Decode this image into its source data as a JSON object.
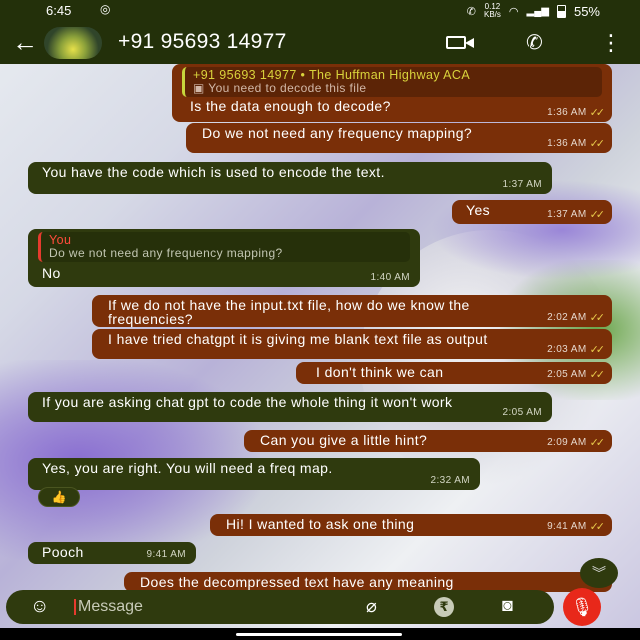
{
  "status": {
    "time": "6:45",
    "notif_icon": "instagram-icon",
    "speed_value": "0.12",
    "speed_unit": "KB/s",
    "battery": "55%"
  },
  "header": {
    "contact": "+91 95693 14977",
    "icons": [
      "back-arrow-icon",
      "video-call-icon",
      "phone-icon",
      "more-menu-icon"
    ]
  },
  "messages": [
    {
      "dir": "out",
      "quote_author": "+91 95693 14977 • The Huffman Highway ACA",
      "quote_text": "You need to decode this file",
      "text": "Is the data enough to decode?",
      "time": "1:36 AM"
    },
    {
      "dir": "out",
      "text": "Do we not need any frequency mapping?",
      "time": "1:36 AM"
    },
    {
      "dir": "in",
      "text": "You have the code which is used to encode the text.",
      "time": "1:37 AM"
    },
    {
      "dir": "out",
      "text": "Yes",
      "time": "1:37 AM"
    },
    {
      "dir": "in",
      "quote_author": "You",
      "quote_text": "Do we not need any frequency mapping?",
      "text": "No",
      "time": "1:40 AM"
    },
    {
      "dir": "out",
      "text": "If we do not have the input.txt file, how do we know the frequencies?",
      "time": "2:02 AM"
    },
    {
      "dir": "out",
      "text": "I have tried chatgpt it is giving me blank text file as output",
      "time": "2:03 AM"
    },
    {
      "dir": "out",
      "text": "I don't think we can",
      "time": "2:05 AM"
    },
    {
      "dir": "in",
      "text": "If you are asking chat gpt to code the whole thing it won't work",
      "time": "2:05 AM"
    },
    {
      "dir": "out",
      "text": "Can you give a little hint?",
      "time": "2:09 AM"
    },
    {
      "dir": "in",
      "text": "Yes, you are right. You will need a freq map.",
      "time": "2:32 AM",
      "reaction": "👍"
    },
    {
      "dir": "out",
      "text": "Hi! I wanted to ask one thing",
      "time": "9:41 AM"
    },
    {
      "dir": "in",
      "text": "Pooch",
      "time": "9:41 AM"
    },
    {
      "dir": "out",
      "text": "Does the decompressed text have any meaning",
      "time": ""
    }
  ],
  "input": {
    "placeholder": "Message"
  },
  "colors": {
    "outgoing": "#7a2f08",
    "incoming": "#2f3a0e",
    "header": "#23300a",
    "mic": "#e8281a"
  }
}
